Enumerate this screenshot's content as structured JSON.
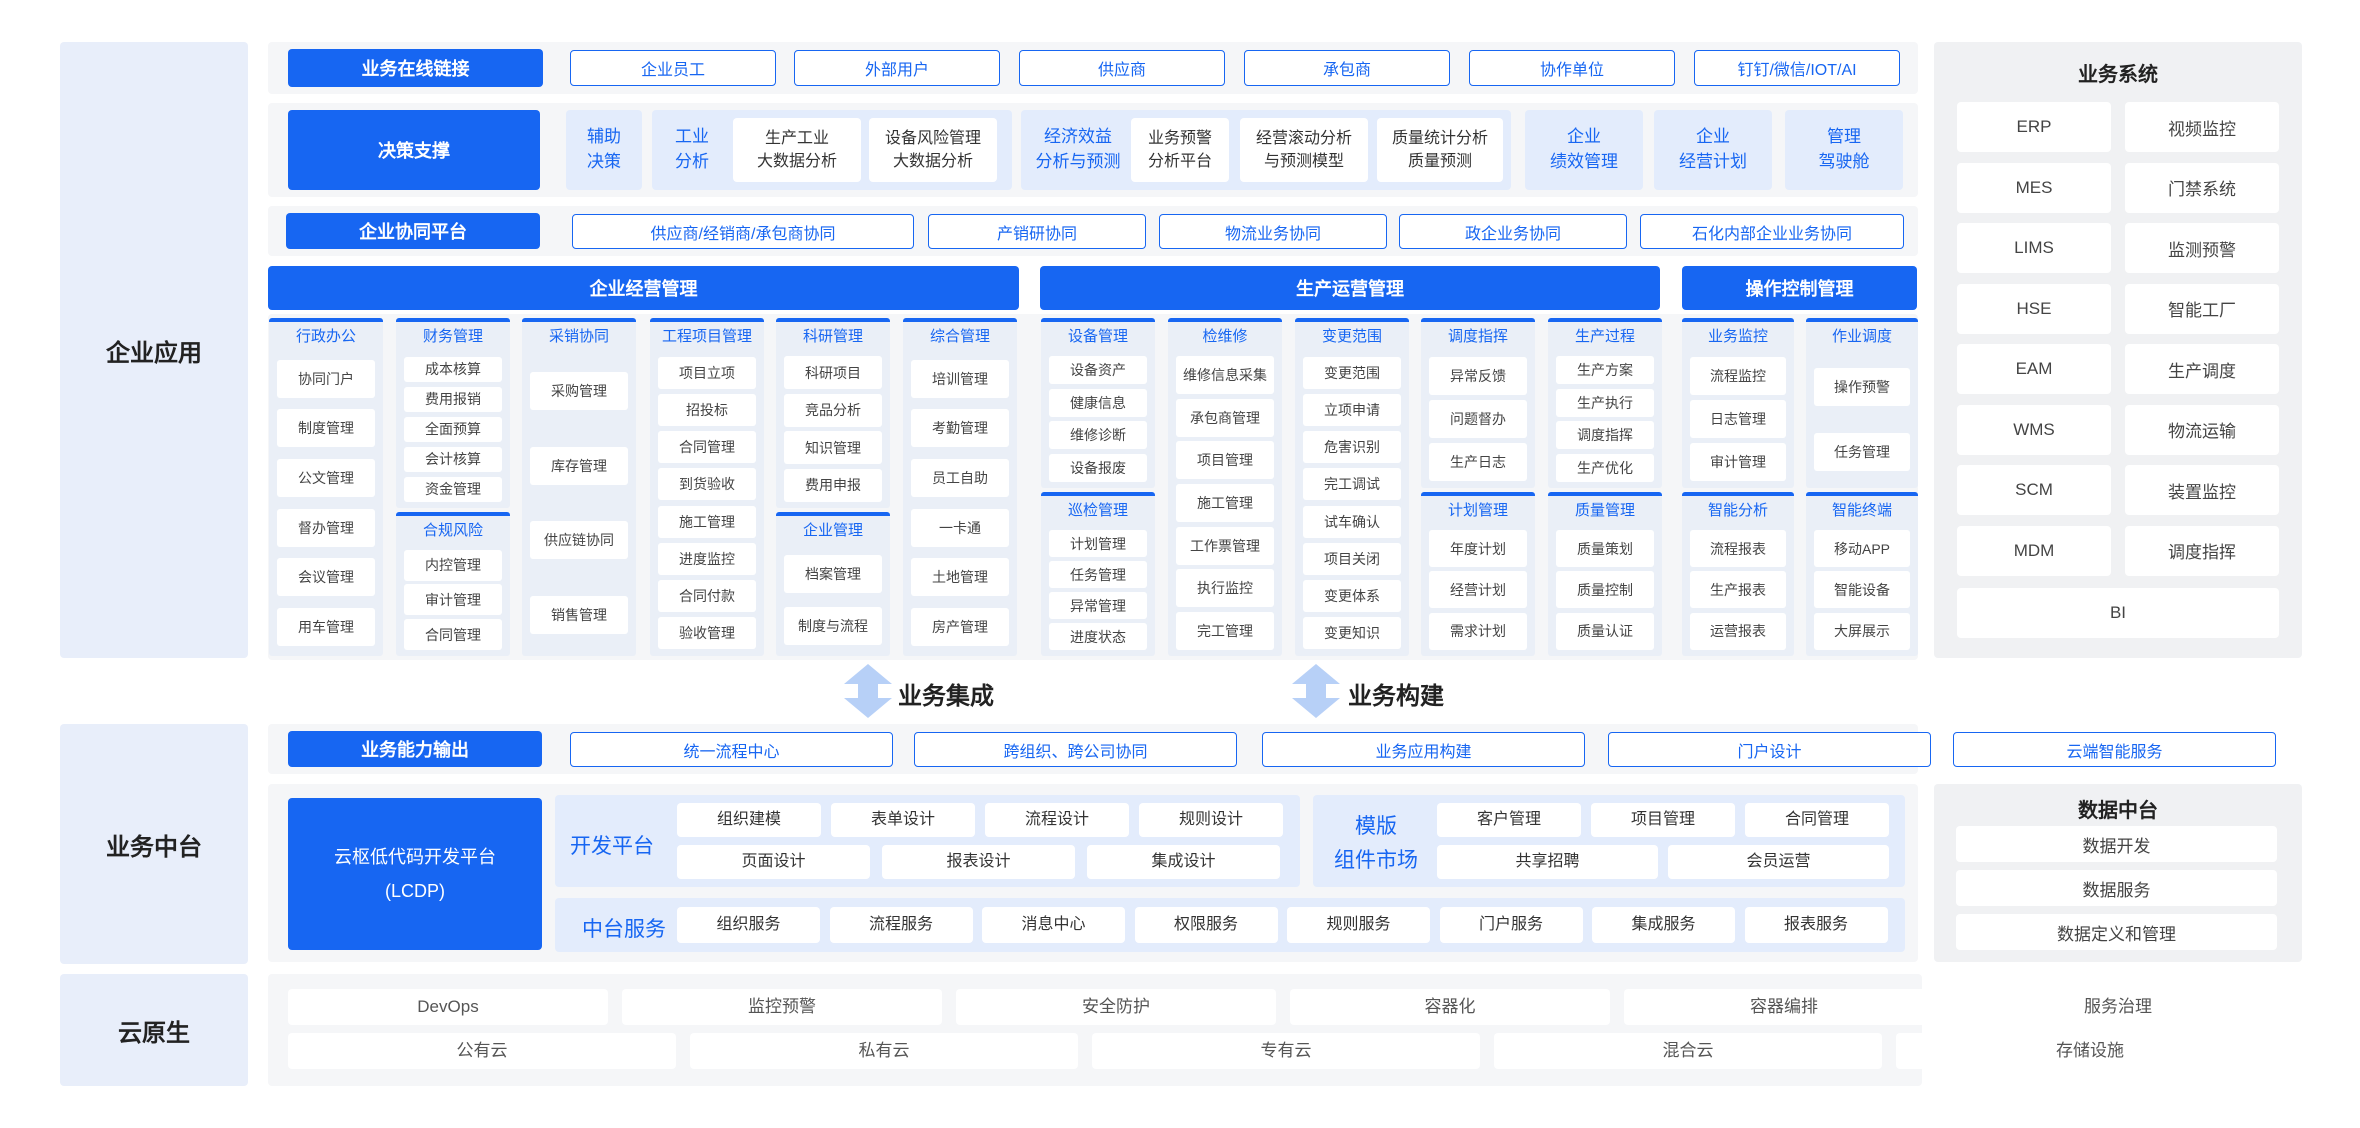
{
  "lanes": {
    "app": "企业应用",
    "middle": "业务中台",
    "cloud": "云原生"
  },
  "online": {
    "title": "业务在线链接",
    "items": [
      "企业员工",
      "外部用户",
      "供应商",
      "承包商",
      "协作单位",
      "钉钉/微信/IOT/AI"
    ]
  },
  "decision": {
    "title": "决策支撑",
    "g1": "辅助\n决策",
    "g2": "工业\n分析",
    "g2a": "生产工业\n大数据分析",
    "g2b": "设备风险管理\n大数据分析",
    "g3": "经济效益\n分析与预测",
    "g3a": "业务预警\n分析平台",
    "g3b": "经营滚动分析\n与预测模型",
    "g3c": "质量统计分析\n质量预测",
    "g4": "企业\n绩效管理",
    "g5": "企业\n经营计划",
    "g6": "管理\n驾驶舱"
  },
  "collab": {
    "title": "企业协同平台",
    "items": [
      "供应商/经销商/承包商协同",
      "产销研协同",
      "物流业务协同",
      "政企业务协同",
      "石化内部企业业务协同"
    ]
  },
  "sections": {
    "biz": "企业经营管理",
    "prod": "生产运营管理",
    "ctrl": "操作控制管理"
  },
  "cols": [
    {
      "title": "行政办公",
      "items": [
        "协同门户",
        "制度管理",
        "公文管理",
        "督办管理",
        "会议管理",
        "用车管理"
      ]
    },
    {
      "title": "财务管理",
      "items": [
        "成本核算",
        "费用报销",
        "全面预算",
        "会计核算",
        "资金管理"
      ]
    },
    {
      "title": "合规风险",
      "items": [
        "内控管理",
        "审计管理",
        "合同管理"
      ]
    },
    {
      "title": "采销协同",
      "items": [
        "采购管理",
        "库存管理",
        "供应链协同",
        "销售管理"
      ]
    },
    {
      "title": "工程项目管理",
      "items": [
        "项目立项",
        "招投标",
        "合同管理",
        "到货验收",
        "施工管理",
        "进度监控",
        "合同付款",
        "验收管理"
      ]
    },
    {
      "title": "科研管理",
      "items": [
        "科研项目",
        "竞品分析",
        "知识管理",
        "费用申报"
      ]
    },
    {
      "title": "企业管理",
      "items": [
        "档案管理",
        "制度与流程"
      ]
    },
    {
      "title": "综合管理",
      "items": [
        "培训管理",
        "考勤管理",
        "员工自助",
        "一卡通",
        "土地管理",
        "房产管理"
      ]
    },
    {
      "title": "设备管理",
      "items": [
        "设备资产",
        "健康信息",
        "维修诊断",
        "设备报废"
      ]
    },
    {
      "title": "巡检管理",
      "items": [
        "计划管理",
        "任务管理",
        "异常管理",
        "进度状态"
      ]
    },
    {
      "title": "检维修",
      "items": [
        "维修信息采集",
        "承包商管理",
        "项目管理",
        "施工管理",
        "工作票管理",
        "执行监控",
        "完工管理"
      ]
    },
    {
      "title": "变更范围",
      "items": [
        "变更范围",
        "立项申请",
        "危害识别",
        "完工调试",
        "试车确认",
        "项目关闭",
        "变更体系",
        "变更知识"
      ]
    },
    {
      "title": "调度指挥",
      "items": [
        "异常反馈",
        "问题督办",
        "生产日志"
      ]
    },
    {
      "title": "计划管理",
      "items": [
        "年度计划",
        "经营计划",
        "需求计划"
      ]
    },
    {
      "title": "生产过程",
      "items": [
        "生产方案",
        "生产执行",
        "调度指挥",
        "生产优化"
      ]
    },
    {
      "title": "质量管理",
      "items": [
        "质量策划",
        "质量控制",
        "质量认证"
      ]
    },
    {
      "title": "业务监控",
      "items": [
        "流程监控",
        "日志管理",
        "审计管理"
      ]
    },
    {
      "title": "智能分析",
      "items": [
        "流程报表",
        "生产报表",
        "运营报表"
      ]
    },
    {
      "title": "作业调度",
      "items": [
        "操作预警",
        "任务管理"
      ]
    },
    {
      "title": "智能终端",
      "items": [
        "移动APP",
        "智能设备",
        "大屏展示"
      ]
    }
  ],
  "systems": {
    "title": "业务系统",
    "items": [
      "ERP",
      "视频监控",
      "MES",
      "门禁系统",
      "LIMS",
      "监测预警",
      "HSE",
      "智能工厂",
      "EAM",
      "生产调度",
      "WMS",
      "物流运输",
      "SCM",
      "装置监控",
      "MDM",
      "调度指挥",
      "BI"
    ]
  },
  "integ": {
    "a": "业务集成",
    "b": "业务构建"
  },
  "cap": {
    "title": "业务能力输出",
    "items": [
      "统一流程中心",
      "跨组织、跨公司协同",
      "业务应用构建",
      "门户设计",
      "云端智能服务"
    ]
  },
  "lcdp": "云枢低代码开发平台\n(LCDP)",
  "devplat": {
    "title": "开发平台",
    "row1": [
      "组织建模",
      "表单设计",
      "流程设计",
      "规则设计"
    ],
    "row2": [
      "页面设计",
      "报表设计",
      "集成设计"
    ]
  },
  "market": {
    "title": "模版\n组件市场",
    "row1": [
      "客户管理",
      "项目管理",
      "合同管理"
    ],
    "row2": [
      "共享招聘",
      "会员运营"
    ]
  },
  "midsvc": {
    "title": "中台服务",
    "items": [
      "组织服务",
      "流程服务",
      "消息中心",
      "权限服务",
      "规则服务",
      "门户服务",
      "集成服务",
      "报表服务"
    ]
  },
  "datahub": {
    "title": "数据中台",
    "items": [
      "数据开发",
      "数据服务",
      "数据定义和管理"
    ]
  },
  "cloud": {
    "row1": [
      "DevOps",
      "监控预警",
      "安全防护",
      "容器化",
      "容器编排",
      "服务治理"
    ],
    "row2": [
      "公有云",
      "私有云",
      "专有云",
      "混合云",
      "存储设施"
    ]
  }
}
